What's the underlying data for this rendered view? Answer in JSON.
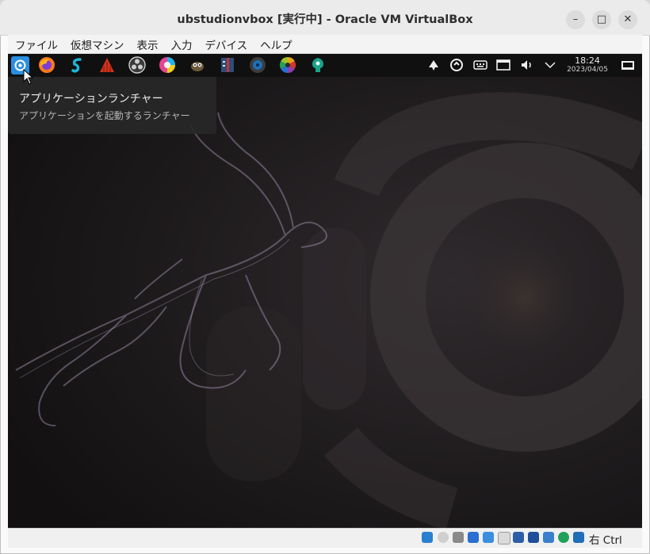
{
  "window": {
    "title": "ubstudionvbox [実行中] - Oracle VM VirtualBox",
    "minimize_glyph": "–",
    "maximize_glyph": "□",
    "close_glyph": "✕"
  },
  "menubar": {
    "items": [
      "ファイル",
      "仮想マシン",
      "表示",
      "入力",
      "デバイス",
      "ヘルプ"
    ]
  },
  "panel": {
    "launchers": [
      {
        "name": "app-launcher-icon",
        "color": "#2a8fe0"
      },
      {
        "name": "firefox-icon",
        "color": "#ff7a1a"
      },
      {
        "name": "s-app-icon",
        "color": "#1fb3d6"
      },
      {
        "name": "ardour-icon",
        "color": "#d0321d"
      },
      {
        "name": "obs-icon",
        "color": "#3a3a3a"
      },
      {
        "name": "color-app-icon",
        "color": "#e84393"
      },
      {
        "name": "gimp-icon",
        "color": "#6b5a3a"
      },
      {
        "name": "media-app-icon",
        "color": "#c83232"
      },
      {
        "name": "blue-disc-icon",
        "color": "#1f6fb8"
      },
      {
        "name": "darktable-icon",
        "color": "#e8a317"
      },
      {
        "name": "green-app-icon",
        "color": "#19a38a"
      }
    ],
    "clock": {
      "time": "18:24",
      "date": "2023/04/05"
    }
  },
  "tooltip": {
    "title": "アプリケーションランチャー",
    "subtitle": "アプリケーションを起動するランチャー"
  },
  "statusbar": {
    "host_key": "右 Ctrl"
  }
}
